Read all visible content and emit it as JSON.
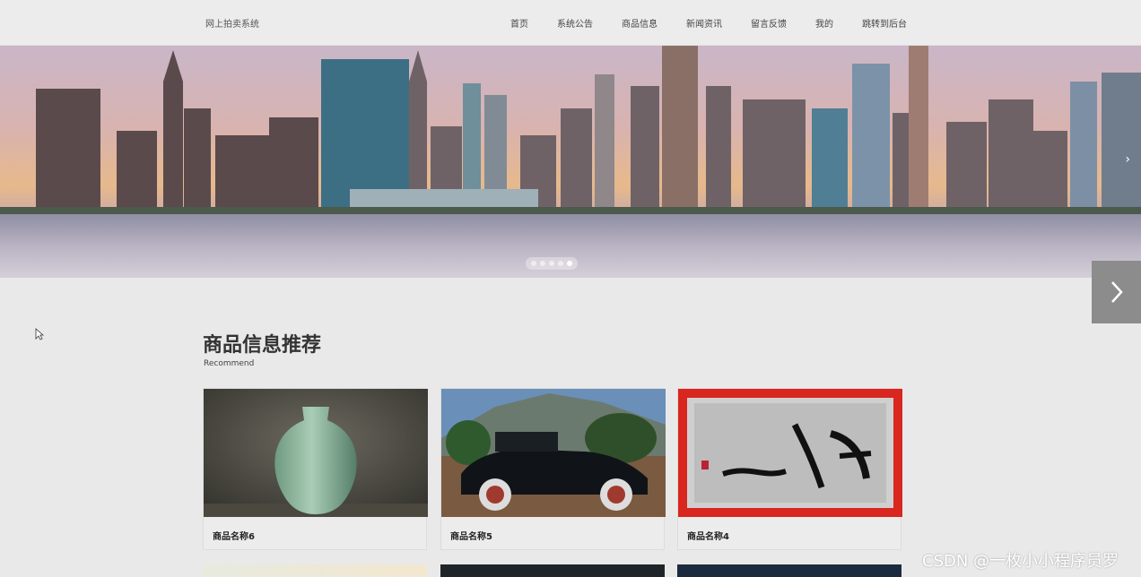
{
  "header": {
    "brand": "网上拍卖系统",
    "nav": [
      "首页",
      "系统公告",
      "商品信息",
      "新闻资讯",
      "留言反馈",
      "我的",
      "跳转到后台"
    ]
  },
  "banner": {
    "slide_count": 5,
    "active_index": 4,
    "arrow": "›"
  },
  "section": {
    "title": "商品信息推荐",
    "subtitle": "Recommend"
  },
  "products": [
    {
      "name": "商品名称6",
      "image": "celadon-vase"
    },
    {
      "name": "商品名称5",
      "image": "vintage-car"
    },
    {
      "name": "商品名称4",
      "image": "calligraphy"
    }
  ],
  "icons": {
    "banner_next": "chevron-right-icon",
    "side_next": "chevron-right-icon",
    "cursor": "mouse-pointer-icon"
  },
  "watermark": "CSDN @一枚小小程序员罗"
}
